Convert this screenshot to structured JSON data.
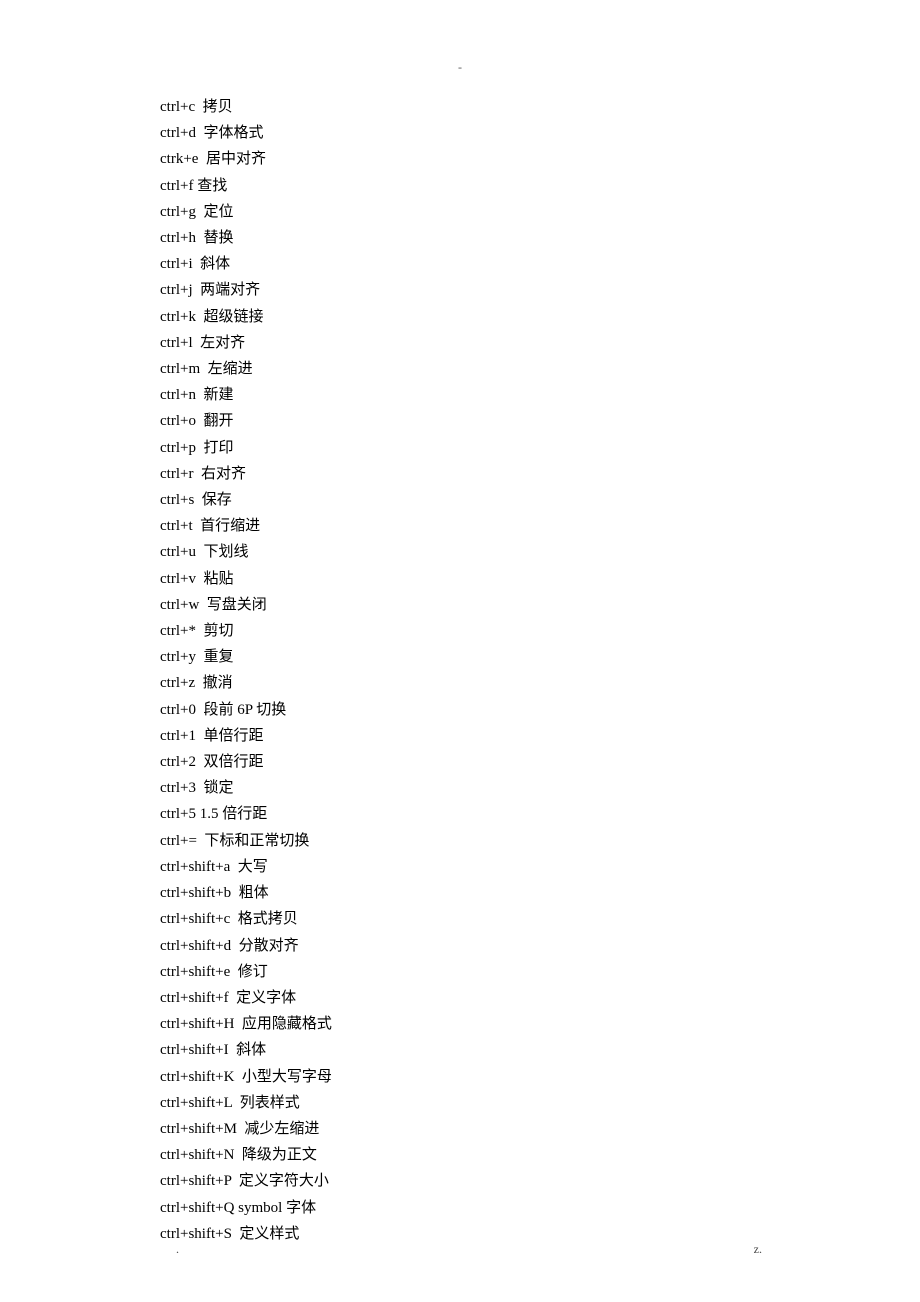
{
  "top_marker": "-",
  "footer_left": ".",
  "footer_right": "z.",
  "shortcuts": [
    {
      "key": "ctrl+c",
      "sep": "  ",
      "desc": "拷贝"
    },
    {
      "key": "ctrl+d",
      "sep": "  ",
      "desc": "字体格式"
    },
    {
      "key": "ctrk+e",
      "sep": "  ",
      "desc": "居中对齐"
    },
    {
      "key": "ctrl+f",
      "sep": " ",
      "desc": "查找"
    },
    {
      "key": "ctrl+g",
      "sep": "  ",
      "desc": "定位"
    },
    {
      "key": "ctrl+h",
      "sep": "  ",
      "desc": "替换"
    },
    {
      "key": "ctrl+i",
      "sep": "  ",
      "desc": "斜体"
    },
    {
      "key": "ctrl+j",
      "sep": "  ",
      "desc": "两端对齐"
    },
    {
      "key": "ctrl+k",
      "sep": "  ",
      "desc": "超级链接"
    },
    {
      "key": "ctrl+l",
      "sep": "  ",
      "desc": "左对齐"
    },
    {
      "key": "ctrl+m",
      "sep": "  ",
      "desc": "左缩进"
    },
    {
      "key": "ctrl+n",
      "sep": "  ",
      "desc": "新建"
    },
    {
      "key": "ctrl+o",
      "sep": "  ",
      "desc": "翻开"
    },
    {
      "key": "ctrl+p",
      "sep": "  ",
      "desc": "打印"
    },
    {
      "key": "ctrl+r",
      "sep": "  ",
      "desc": "右对齐"
    },
    {
      "key": "ctrl+s",
      "sep": "  ",
      "desc": "保存"
    },
    {
      "key": "ctrl+t",
      "sep": "  ",
      "desc": "首行缩进"
    },
    {
      "key": "ctrl+u",
      "sep": "  ",
      "desc": "下划线"
    },
    {
      "key": "ctrl+v",
      "sep": "  ",
      "desc": "粘贴"
    },
    {
      "key": "ctrl+w",
      "sep": "  ",
      "desc": "写盘关闭"
    },
    {
      "key": "ctrl+*",
      "sep": "  ",
      "desc": "剪切"
    },
    {
      "key": "ctrl+y",
      "sep": "  ",
      "desc": "重复"
    },
    {
      "key": "ctrl+z",
      "sep": "  ",
      "desc": "撤消"
    },
    {
      "key": "ctrl+0",
      "sep": "  ",
      "desc": "段前 6P 切换"
    },
    {
      "key": "ctrl+1",
      "sep": "  ",
      "desc": "单倍行距"
    },
    {
      "key": "ctrl+2",
      "sep": "  ",
      "desc": "双倍行距"
    },
    {
      "key": "ctrl+3",
      "sep": "  ",
      "desc": "锁定"
    },
    {
      "key": "ctrl+5",
      "sep": " ",
      "desc": "1.5 倍行距"
    },
    {
      "key": "ctrl+=",
      "sep": "  ",
      "desc": "下标和正常切换"
    },
    {
      "key": "ctrl+shift+a",
      "sep": "  ",
      "desc": "大写"
    },
    {
      "key": "ctrl+shift+b",
      "sep": "  ",
      "desc": "粗体"
    },
    {
      "key": "ctrl+shift+c",
      "sep": "  ",
      "desc": "格式拷贝"
    },
    {
      "key": "ctrl+shift+d",
      "sep": "  ",
      "desc": "分散对齐"
    },
    {
      "key": "ctrl+shift+e",
      "sep": "  ",
      "desc": "修订"
    },
    {
      "key": "ctrl+shift+f",
      "sep": "  ",
      "desc": "定义字体"
    },
    {
      "key": "ctrl+shift+H",
      "sep": "  ",
      "desc": "应用隐藏格式"
    },
    {
      "key": "ctrl+shift+I",
      "sep": "  ",
      "desc": "斜体"
    },
    {
      "key": "ctrl+shift+K",
      "sep": "  ",
      "desc": "小型大写字母"
    },
    {
      "key": "ctrl+shift+L",
      "sep": "  ",
      "desc": "列表样式"
    },
    {
      "key": "ctrl+shift+M",
      "sep": "  ",
      "desc": "减少左缩进"
    },
    {
      "key": "ctrl+shift+N",
      "sep": "  ",
      "desc": "降级为正文"
    },
    {
      "key": "ctrl+shift+P",
      "sep": "  ",
      "desc": "定义字符大小"
    },
    {
      "key": "ctrl+shift+Q",
      "sep": " ",
      "desc": "symbol 字体"
    },
    {
      "key": "ctrl+shift+S",
      "sep": "  ",
      "desc": "定义样式"
    }
  ]
}
